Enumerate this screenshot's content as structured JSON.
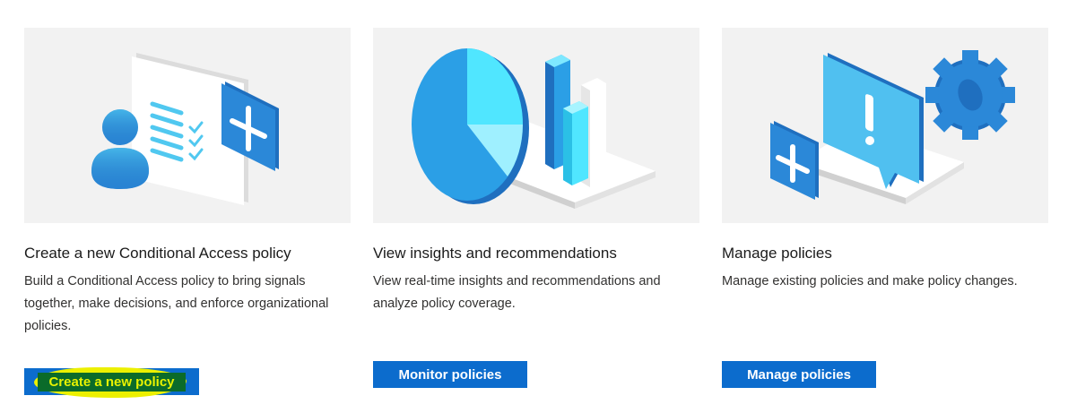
{
  "cards": [
    {
      "title": "Create a new Conditional Access policy",
      "description": "Build a Conditional Access policy to bring signals together, make decisions, and enforce organizational policies.",
      "button_label": "Create a new policy",
      "illustration_icon": "user-checklist-plus-icon"
    },
    {
      "title": "View insights and recommendations",
      "description": "View real-time insights and recommendations and analyze policy coverage.",
      "button_label": "Monitor policies",
      "illustration_icon": "pie-bar-chart-icon"
    },
    {
      "title": "Manage policies",
      "description": "Manage existing policies and make policy changes.",
      "button_label": "Manage policies",
      "illustration_icon": "alert-gear-plus-icon"
    }
  ],
  "colors": {
    "button_blue": "#0c6ccd",
    "highlight_yellow": "#ecf000",
    "illustration_bg": "#f2f2f2",
    "accent_blue": "#2b88d8",
    "accent_cyan": "#50e6ff"
  }
}
